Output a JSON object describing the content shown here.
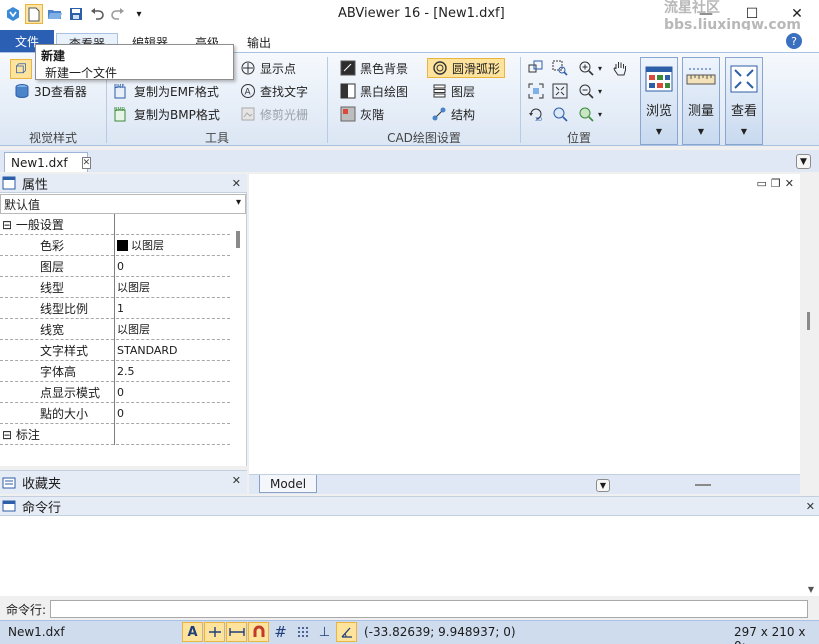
{
  "window": {
    "title": "ABViewer 16 - [New1.dxf]",
    "watermark_line1": "流星社区",
    "watermark_line2": "bbs.liuxingw.com",
    "minimize_glyph": "—",
    "maximize_glyph": "☐",
    "close_glyph": "✕"
  },
  "qat": {
    "icons": [
      "app-logo-icon",
      "new-file-icon",
      "open-folder-icon",
      "save-icon",
      "undo-icon",
      "redo-icon",
      "customize-qat-icon"
    ]
  },
  "ribbon_tabs": [
    "文件",
    "查看器",
    "编辑器",
    "高级",
    "输出"
  ],
  "tooltip": {
    "title": "新建",
    "description": "新建一个文件"
  },
  "ribbon": {
    "visual_style": {
      "label": "视觉样式",
      "viewer3d": "3D查看器"
    },
    "tools": {
      "label": "工具",
      "copy_emf": "复制为EMF格式",
      "copy_bmp": "复制为BMP格式",
      "show_points": "显示点",
      "find_text": "查找文字",
      "trim_raster": "修剪光栅"
    },
    "cad_settings": {
      "label": "CAD绘图设置",
      "black_bg": "黑色背景",
      "bw_drawing": "黑白绘图",
      "gray": "灰階",
      "smooth_arcs": "圆滑弧形",
      "layers": "图层",
      "structure": "结构"
    },
    "position": {
      "label": "位置"
    },
    "big_buttons": {
      "browse": "浏览",
      "measure": "测量",
      "view": "查看"
    }
  },
  "doc_tab": {
    "name": "New1.dxf"
  },
  "properties_panel": {
    "title": "属性",
    "preset": "默认值",
    "rows": [
      {
        "kind": "category",
        "name": "⊟ 一般设置",
        "value": ""
      },
      {
        "kind": "prop",
        "name": "色彩",
        "value": "以图层",
        "swatch": "#000000"
      },
      {
        "kind": "prop",
        "name": "图层",
        "value": "0"
      },
      {
        "kind": "prop",
        "name": "线型",
        "value": "以图层"
      },
      {
        "kind": "prop",
        "name": "线型比例",
        "value": "1"
      },
      {
        "kind": "prop",
        "name": "线宽",
        "value": "以图层"
      },
      {
        "kind": "prop",
        "name": "文字样式",
        "value": "STANDARD"
      },
      {
        "kind": "prop",
        "name": "字体高",
        "value": "2.5"
      },
      {
        "kind": "prop",
        "name": "点显示模式",
        "value": "0"
      },
      {
        "kind": "prop",
        "name": "點的大小",
        "value": "0"
      },
      {
        "kind": "category",
        "name": "⊟ 标注",
        "value": ""
      }
    ]
  },
  "favorites_panel": {
    "title": "收藏夹"
  },
  "layout_tabs": {
    "model": "Model"
  },
  "command_panel": {
    "title": "命令行",
    "prompt_label": "命令行:",
    "input_value": ""
  },
  "statusbar": {
    "file": "New1.dxf",
    "coordinates": "(-33.82639; 9.948937; 0)",
    "paper": "297 x 210 x 0;",
    "snap_icons": [
      "text-snap-icon",
      "ortho-icon",
      "dimension-icon",
      "magnet-icon",
      "grid-icon",
      "dot-grid-icon",
      "perpendicular-icon",
      "polar-icon"
    ]
  },
  "colors": {
    "file_tab": "#2b5fb4",
    "ribbon_bg": "#dbe6f4",
    "highlight": "#fde39c",
    "statusbar": "#cfdcee"
  }
}
